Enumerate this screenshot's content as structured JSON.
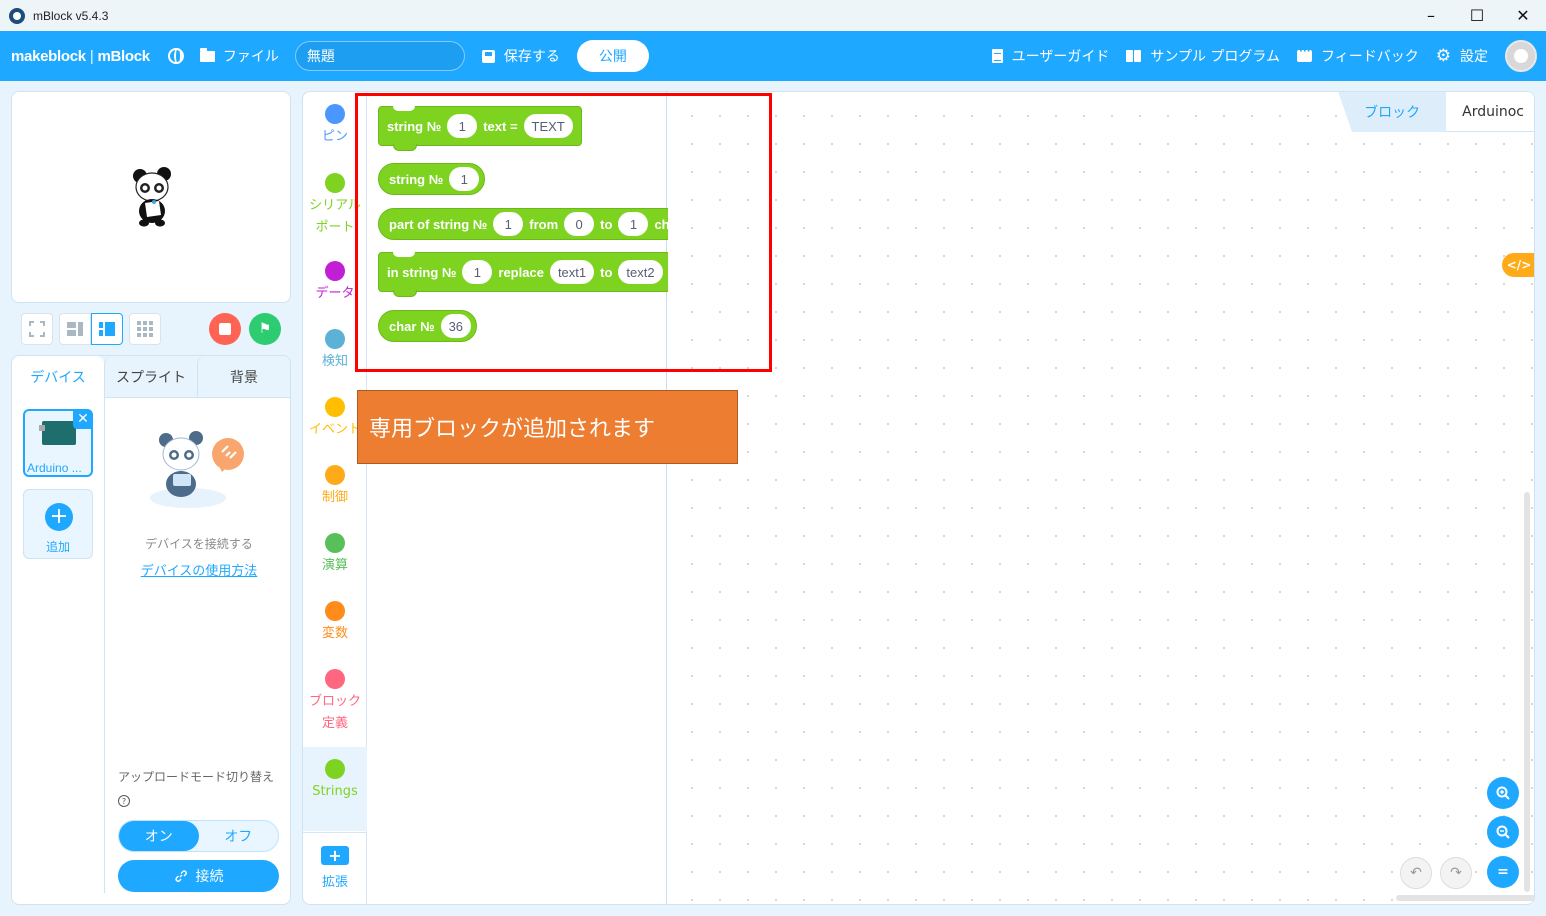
{
  "window": {
    "title": "mBlock v5.4.3",
    "controls": {
      "minimize": "–",
      "maximize": "☐",
      "close": "✕"
    }
  },
  "header": {
    "brand": "makeblock",
    "product": "mBlock",
    "file_menu": "ファイル",
    "project_name": "無題",
    "save_label": "保存する",
    "publish_label": "公開",
    "user_guide": "ユーザーガイド",
    "samples": "サンプル プログラム",
    "feedback": "フィードバック",
    "settings": "設定",
    "settings_icon": "⚙"
  },
  "stage_controls": {
    "stop_icon": "stop-icon",
    "go_icon": "⚑"
  },
  "device_panel": {
    "tabs": [
      "デバイス",
      "スプライト",
      "背景"
    ],
    "active_tab": 0,
    "device_name": "Arduino ...",
    "remove_icon": "✕",
    "add_icon": "+",
    "add_label": "追加",
    "connect_hint": "デバイスを接続する",
    "howto_link": "デバイスの使用方法",
    "upload_mode_label": "アップロードモード切り替え",
    "help_icon": "?",
    "mode_on": "オン",
    "mode_off": "オフ",
    "upload_mode_on": true,
    "connect_icon": "🔗",
    "connect_label": "接続"
  },
  "categories": [
    {
      "label": "ピン",
      "color": "#4c97ff"
    },
    {
      "label": "シリアル\nポート",
      "color": "#7ed321"
    },
    {
      "label": "データ",
      "color": "#c21ed6"
    },
    {
      "label": "検知",
      "color": "#5cb1d6"
    },
    {
      "label": "イベント",
      "color": "#ffbf00"
    },
    {
      "label": "制御",
      "color": "#ffab19"
    },
    {
      "label": "演算",
      "color": "#59c059"
    },
    {
      "label": "変数",
      "color": "#ff8c1a"
    },
    {
      "label": "ブロック\n定義",
      "color": "#ff6680"
    },
    {
      "label": "Strings",
      "color": "#7ed321"
    }
  ],
  "active_category": "Strings",
  "extension": {
    "icon": "+",
    "label": "拡張"
  },
  "blocks": [
    {
      "type": "command",
      "parts": [
        {
          "text": "string №"
        },
        {
          "slot": "1"
        },
        {
          "text": "text ="
        },
        {
          "slot": "TEXT"
        }
      ]
    },
    {
      "type": "reporter",
      "parts": [
        {
          "text": "string №"
        },
        {
          "slot": "1"
        }
      ]
    },
    {
      "type": "reporter",
      "parts": [
        {
          "text": "part of string №"
        },
        {
          "slot": "1"
        },
        {
          "text": "from"
        },
        {
          "slot": "0"
        },
        {
          "text": "to"
        },
        {
          "slot": "1"
        },
        {
          "text": "chars"
        }
      ]
    },
    {
      "type": "command",
      "parts": [
        {
          "text": "in string №"
        },
        {
          "slot": "1"
        },
        {
          "text": "replace"
        },
        {
          "slot": "text1"
        },
        {
          "text": "to"
        },
        {
          "slot": "text2"
        }
      ]
    },
    {
      "type": "reporter",
      "parts": [
        {
          "text": "char №"
        },
        {
          "slot": "36"
        }
      ]
    }
  ],
  "view_tabs": {
    "blocks": "ブロック",
    "code": "Arduinoc"
  },
  "code_toggle": "</>",
  "zoom": {
    "in": "+",
    "out": "−",
    "reset": "="
  },
  "undo_icon": "↶",
  "redo_icon": "↷",
  "annotation": {
    "callout_text": "専用ブロックが追加されます",
    "highlight_color": "#ff0000",
    "callout_color": "#ed7d31"
  },
  "colors": {
    "brand_blue": "#1fa8ff",
    "string_block": "#7ed321"
  }
}
